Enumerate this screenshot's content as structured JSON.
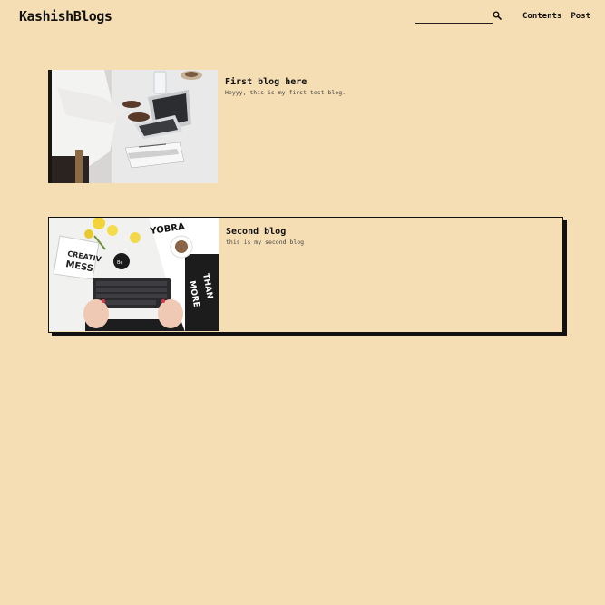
{
  "header": {
    "brand": "KashishBlogs",
    "search": {
      "placeholder": "",
      "value": ""
    },
    "nav": [
      "Contents",
      "Post"
    ]
  },
  "posts": [
    {
      "title": "First blog here",
      "description": "Heyyy, this is my first test blog.",
      "image": "laptop-workspace-photo"
    },
    {
      "title": "Second blog",
      "description": "this is my second blog",
      "image": "keyboard-desk-flatlay-photo"
    }
  ],
  "colors": {
    "background": "#f6deb4",
    "text": "#111111"
  }
}
